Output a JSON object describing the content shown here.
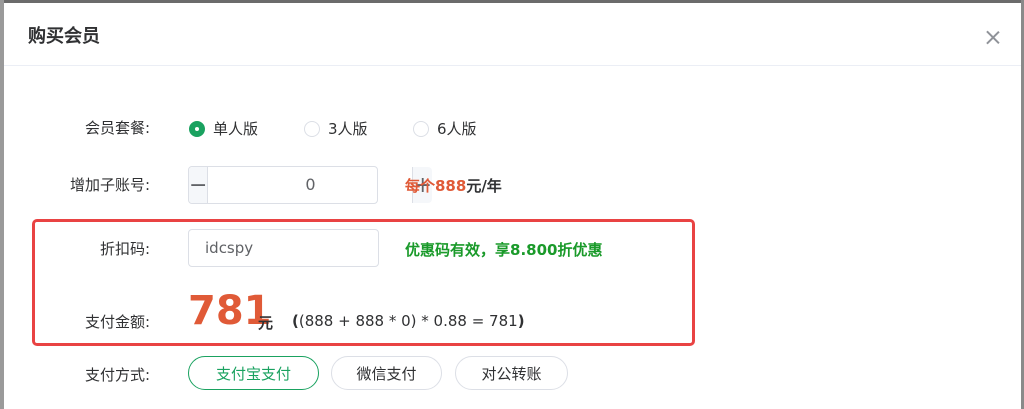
{
  "dialog": {
    "title": "购买会员"
  },
  "plan": {
    "label": "会员套餐:",
    "options": [
      {
        "label": "单人版",
        "selected": true
      },
      {
        "label": "3人版",
        "selected": false
      },
      {
        "label": "6人版",
        "selected": false
      }
    ]
  },
  "sub_accounts": {
    "label": "增加子账号:",
    "value": "0",
    "minus": "−",
    "plus": "+",
    "price_note": "每个888",
    "price_unit": "元/年"
  },
  "coupon": {
    "label": "折扣码:",
    "value": "idcspy",
    "status": "优惠码有效，享8.800折优惠"
  },
  "payment": {
    "label": "支付金额:",
    "amount": "781",
    "unit": "元",
    "formula_open": "(",
    "formula": "(888 + 888 * 0) * 0.88 = 781",
    "formula_close": ")"
  },
  "pay_method": {
    "label": "支付方式:",
    "options": [
      {
        "label": "支付宝支付",
        "active": true
      },
      {
        "label": "微信支付",
        "active": false
      },
      {
        "label": "对公转账",
        "active": false
      }
    ]
  },
  "colors": {
    "accent_green": "#1aa260",
    "price_red": "#e05a37",
    "highlight_box": "#e94343",
    "success_green": "#1a9a2a"
  }
}
